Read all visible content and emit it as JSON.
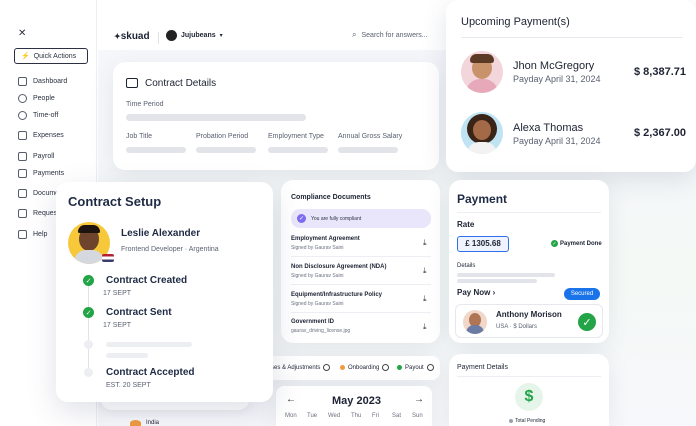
{
  "sidebar": {
    "close_glyph": "✕",
    "quick_actions": "Quick Actions",
    "items": [
      {
        "label": "Dashboard",
        "icon": "grid-icon"
      },
      {
        "label": "People",
        "icon": "people-icon"
      },
      {
        "label": "Time-off",
        "icon": "clock-icon"
      },
      {
        "label": "Expenses",
        "icon": "chart-icon"
      },
      {
        "label": "Payroll",
        "icon": "wallet-icon"
      },
      {
        "label": "Payments",
        "icon": "card-icon"
      },
      {
        "label": "Docume",
        "icon": "document-icon"
      },
      {
        "label": "Request",
        "icon": "message-icon"
      },
      {
        "label": "Help",
        "icon": "help-icon"
      }
    ]
  },
  "topbar": {
    "logo": "skuad",
    "company": "Jujubeans",
    "search_placeholder": "Search for answers..."
  },
  "contract_details": {
    "title": "Contract Details",
    "time_period": "Time Period",
    "columns": [
      "Job Title",
      "Probation Period",
      "Employment Type",
      "Annual Gross Salary"
    ]
  },
  "upcoming_payments": {
    "title": "Upcoming Payment(s)",
    "items": [
      {
        "name": "Jhon McGregory",
        "payday": "Payday April 31, 2024",
        "amount": "$ 8,387.71"
      },
      {
        "name": "Alexa Thomas",
        "payday": "Payday April 31, 2024",
        "amount": "$ 2,367.00"
      }
    ]
  },
  "compliance": {
    "title": "Compliance Documents",
    "banner": "You are fully compliant",
    "docs": [
      {
        "title": "Employment Agreement",
        "sub": "Signed by Gaurav Saini"
      },
      {
        "title": "Non Disclosure Agreement (NDA)",
        "sub": "Signed by Gaurav Saini"
      },
      {
        "title": "Equipment/Infrastructure Policy",
        "sub": "Signed by Gaurav Saini"
      },
      {
        "title": "Government ID",
        "sub": "gaurav_driving_license.jpg"
      }
    ]
  },
  "tabs_row": {
    "first": "ses & Adjustments",
    "onboarding": "Onboarding",
    "payout": "Payout"
  },
  "calendar": {
    "month": "May",
    "year": "2023",
    "days": [
      "Mon",
      "Tue",
      "Wed",
      "Thu",
      "Fri",
      "Sat",
      "Sun"
    ]
  },
  "payment": {
    "title": "Payment",
    "rate_label": "Rate",
    "rate_value": "£ 1305.68",
    "status": "Payment Done",
    "details_label": "Details",
    "pay_now": "Pay Now",
    "secured": "Secured",
    "person_name": "Anthony Morison",
    "person_meta": "USA · $ Dollars"
  },
  "payment_details": {
    "title": "Payment Details",
    "total_pending": "Total Pending"
  },
  "contract_setup": {
    "title": "Contract Setup",
    "name": "Leslie Alexander",
    "role": "Frontend Developer · Argentina",
    "steps": [
      {
        "title": "Contract Created",
        "date": "17 SEPT"
      },
      {
        "title": "Contract Sent",
        "date": "17 SEPT"
      },
      {
        "title": "Contract Accepted",
        "date": "EST. 20 SEPT"
      }
    ]
  },
  "partial_list": {
    "india": "India"
  },
  "colors": {
    "accent_green": "#22a447",
    "accent_purple": "#7c6cf0",
    "secured_blue": "#1a73e8",
    "rate_blue_border": "#2f6fea"
  }
}
